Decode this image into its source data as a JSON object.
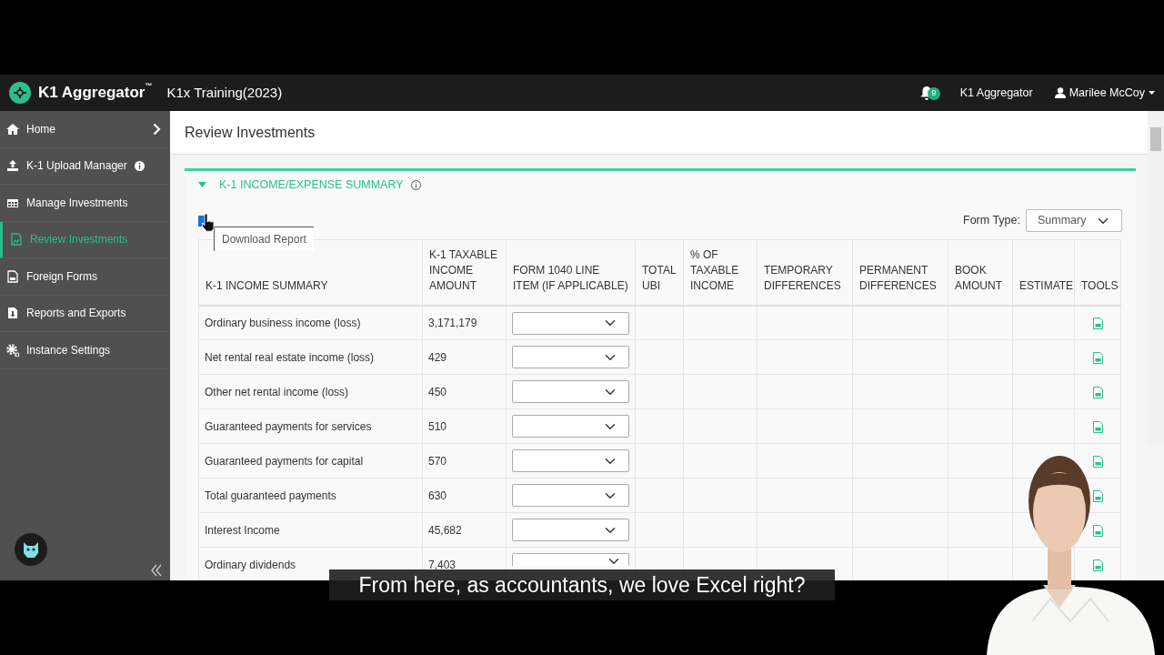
{
  "top_bar": {
    "brand": "K1 Aggregator",
    "trademark": "™",
    "instance": "K1x Training(2023)",
    "notifications": "9",
    "app_link": "K1 Aggregator",
    "user": "Marilee McCoy"
  },
  "sidebar": {
    "items": [
      {
        "label": "Home",
        "kind": "home",
        "selected": false,
        "has_info": false,
        "has_submenu": true
      },
      {
        "label": "K-1 Upload Manager",
        "kind": "upload",
        "selected": false,
        "has_info": true,
        "has_submenu": false
      },
      {
        "label": "Manage Investments",
        "kind": "grid",
        "selected": false,
        "has_info": false,
        "has_submenu": false
      },
      {
        "label": "Review Investments",
        "kind": "chart",
        "selected": true,
        "has_info": false,
        "has_submenu": false
      },
      {
        "label": "Foreign Forms",
        "kind": "form",
        "selected": false,
        "has_info": false,
        "has_submenu": false
      },
      {
        "label": "Reports and Exports",
        "kind": "download",
        "selected": false,
        "has_info": false,
        "has_submenu": false
      },
      {
        "label": "Instance Settings",
        "kind": "gears",
        "selected": false,
        "has_info": false,
        "has_submenu": false
      }
    ]
  },
  "page": {
    "title": "Review Investments"
  },
  "section": {
    "title": "K-1 INCOME/EXPENSE SUMMARY",
    "expanded": true,
    "tooltip": "Download Report",
    "form_type_label": "Form Type:",
    "form_type": "Summary"
  },
  "table": {
    "columns": [
      "K-1 INCOME SUMMARY",
      "K-1 TAXABLE INCOME AMOUNT",
      "FORM 1040 LINE ITEM (IF APPLICABLE)",
      "TOTAL UBI",
      "% OF TAXABLE INCOME",
      "TEMPORARY DIFFERENCES",
      "PERMANENT DIFFERENCES",
      "BOOK AMOUNT",
      "ESTIMATE",
      "TOOLS"
    ],
    "rows": [
      {
        "label": "Ordinary business income (loss)",
        "amount": "3,171,179"
      },
      {
        "label": "Net rental real estate income (loss)",
        "amount": "429"
      },
      {
        "label": "Other net rental income (loss)",
        "amount": "450"
      },
      {
        "label": "Guaranteed payments for services",
        "amount": "510"
      },
      {
        "label": "Guaranteed payments for capital",
        "amount": "570"
      },
      {
        "label": "Total guaranteed payments",
        "amount": "630"
      },
      {
        "label": "Interest Income",
        "amount": "45,682"
      },
      {
        "label": "Ordinary dividends",
        "amount": "7,403"
      }
    ]
  },
  "subtitle": "From here, as accountants, we love Excel right?"
}
